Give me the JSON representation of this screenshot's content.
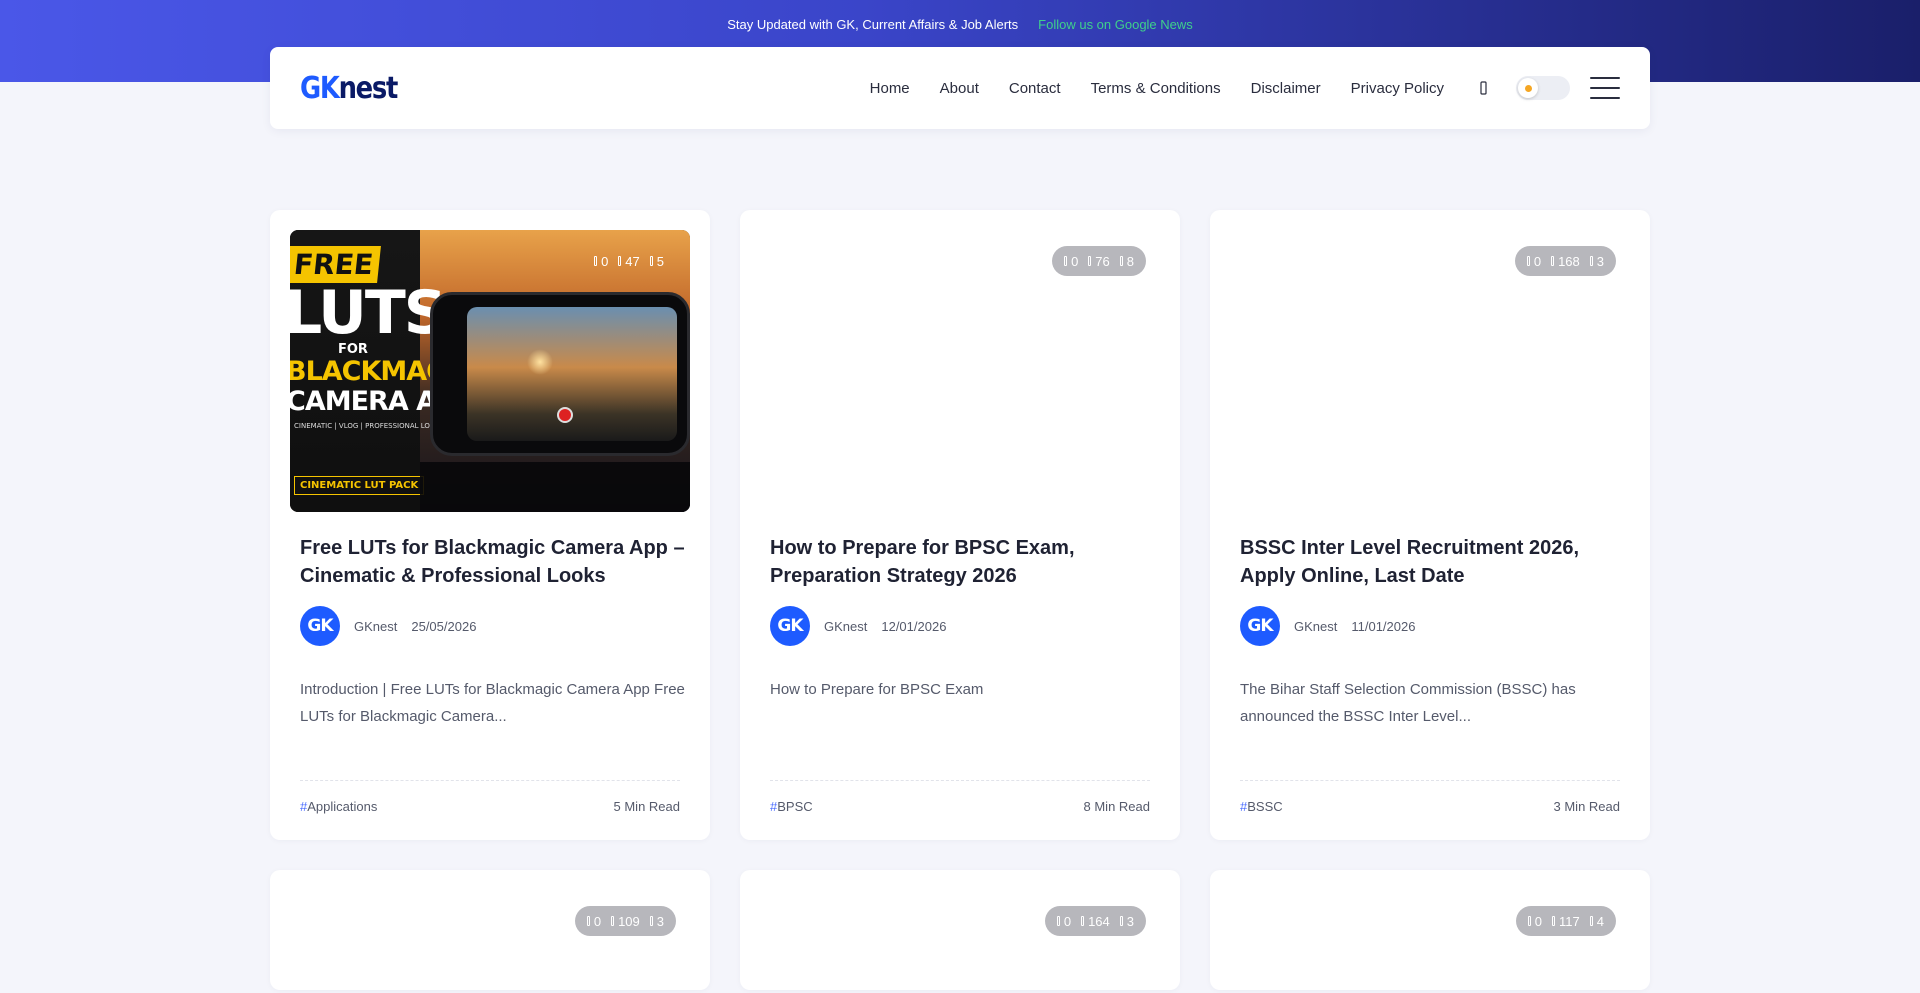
{
  "announcement": {
    "message": "Stay Updated with GK, Current Affairs & Job Alerts",
    "link_label": "Follow us on Google News"
  },
  "header": {
    "logo": {
      "part1": "GK",
      "part2": "nest"
    },
    "nav": [
      "Home",
      "About",
      "Contact",
      "Terms & Conditions",
      "Disclaimer",
      "Privacy Policy"
    ],
    "icons": [
      "search-icon",
      "theme-toggle",
      "menu-icon"
    ]
  },
  "colors": {
    "accent": "#1e5bff",
    "banner_start": "#4a57e8",
    "banner_end": "#1a1f6a",
    "news_link": "#3fd08b"
  },
  "posts": [
    {
      "title": "Free LUTs for Blackmagic Camera App – Cinematic & Professional Looks",
      "author": "GKnest",
      "date": "25/05/2026",
      "excerpt": "Introduction | Free LUTs for Blackmagic Camera App Free LUTs for Blackmagic Camera...",
      "tag": "Applications",
      "read_time": "5 Min Read",
      "stats": {
        "comments": "0",
        "views": "47",
        "time": "5"
      },
      "image_text": {
        "free": "FREE",
        "luts": "LUTS",
        "for": "FOR",
        "blackmagic": "BLACKMAGIC",
        "camera_app": "CAMERA APP",
        "sub": "CINEMATIC | VLOG | PROFESSIONAL LOOKS",
        "pack": "CINEMATIC LUT PACK"
      }
    },
    {
      "title": "How to Prepare for BPSC Exam, Preparation Strategy 2026",
      "author": "GKnest",
      "date": "12/01/2026",
      "excerpt": "How to Prepare for BPSC Exam",
      "tag": "BPSC",
      "read_time": "8 Min Read",
      "stats": {
        "comments": "0",
        "views": "76",
        "time": "8"
      }
    },
    {
      "title": "BSSC Inter Level Recruitment 2026, Apply Online, Last Date",
      "author": "GKnest",
      "date": "11/01/2026",
      "excerpt": "The Bihar Staff Selection Commission (BSSC) has announced the BSSC Inter Level...",
      "tag": "BSSC",
      "read_time": "3 Min Read",
      "stats": {
        "comments": "0",
        "views": "168",
        "time": "3"
      }
    },
    {
      "stats": {
        "comments": "0",
        "views": "109",
        "time": "3"
      }
    },
    {
      "stats": {
        "comments": "0",
        "views": "164",
        "time": "3"
      }
    },
    {
      "stats": {
        "comments": "0",
        "views": "117",
        "time": "4"
      }
    }
  ],
  "avatar_text": "GK",
  "tag_prefix": "#"
}
